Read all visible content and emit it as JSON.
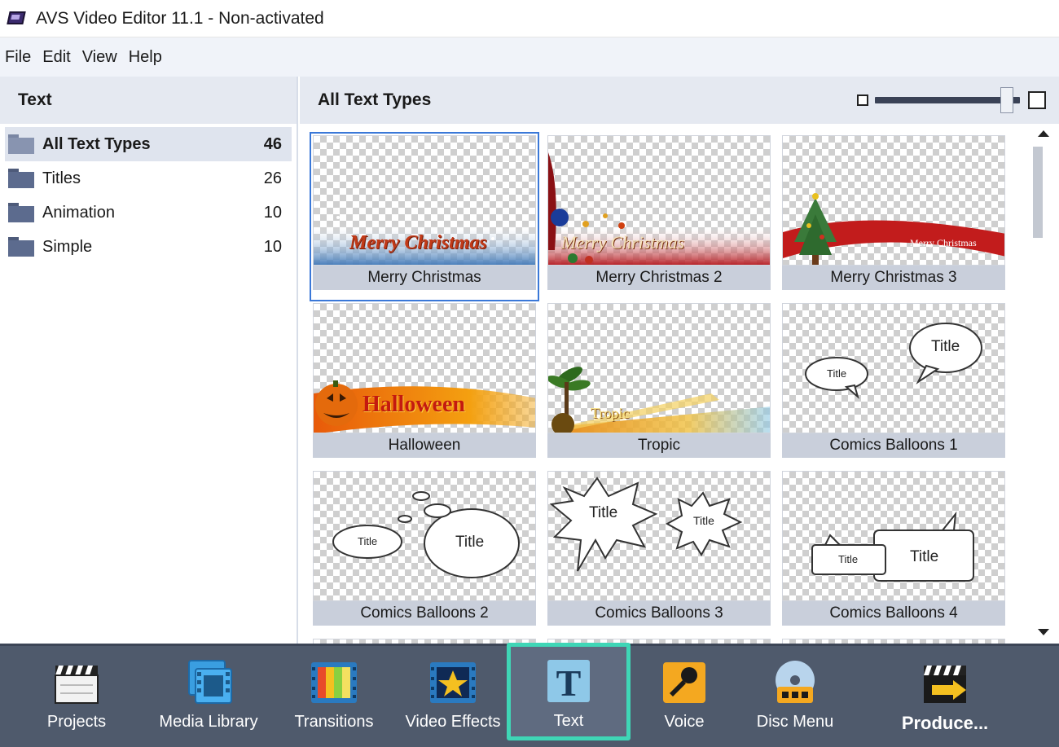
{
  "window": {
    "title": "AVS Video Editor 11.1 - Non-activated",
    "icon": "film-app-icon"
  },
  "menu": [
    "File",
    "Edit",
    "View",
    "Help"
  ],
  "left_panel": {
    "header": "Text",
    "categories": [
      {
        "label": "All Text Types",
        "count": "46",
        "selected": true
      },
      {
        "label": "Titles",
        "count": "26",
        "selected": false
      },
      {
        "label": "Animation",
        "count": "10",
        "selected": false
      },
      {
        "label": "Simple",
        "count": "10",
        "selected": false
      }
    ]
  },
  "right_panel": {
    "header": "All Text Types",
    "zoom_level": 0.95,
    "tiles": [
      {
        "label": "Merry Christmas",
        "art_text": "Merry Christmas",
        "selected": true
      },
      {
        "label": "Merry Christmas 2",
        "art_text": "Merry Christmas"
      },
      {
        "label": "Merry Christmas 3",
        "art_text": "Merry Christmas"
      },
      {
        "label": "Halloween",
        "art_text": "Halloween"
      },
      {
        "label": "Tropic",
        "art_text": "Tropic"
      },
      {
        "label": "Comics Balloons 1",
        "art_text": "Title"
      },
      {
        "label": "Comics Balloons 2",
        "art_text": "Title"
      },
      {
        "label": "Comics Balloons 3",
        "art_text": "Title"
      },
      {
        "label": "Comics Balloons 4",
        "art_text": "Title"
      }
    ]
  },
  "toolbar": {
    "items": [
      {
        "label": "Projects",
        "icon": "clapperboard-icon"
      },
      {
        "label": "Media Library",
        "icon": "film-strip-icon"
      },
      {
        "label": "Transitions",
        "icon": "transitions-icon"
      },
      {
        "label": "Video Effects",
        "icon": "star-effects-icon"
      },
      {
        "label": "Text",
        "icon": "text-t-icon",
        "active": true
      },
      {
        "label": "Voice",
        "icon": "microphone-icon"
      },
      {
        "label": "Disc Menu",
        "icon": "disc-menu-icon"
      },
      {
        "label": "Produce...",
        "icon": "produce-clapper-icon"
      }
    ]
  },
  "colors": {
    "accent_active": "#3fd6b6",
    "toolbar_bg": "#4f5a6c",
    "selection_blue": "#3a78d8",
    "panel_header": "#e5e9f1"
  }
}
